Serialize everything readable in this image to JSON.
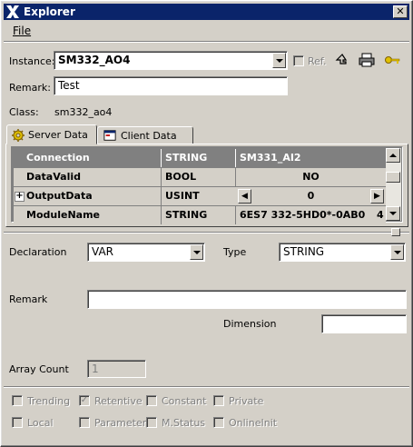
{
  "window": {
    "title": "Explorer"
  },
  "menu": {
    "file": "File"
  },
  "instance": {
    "label": "Instance:",
    "value": "SM332_AO4",
    "ref_label": "Ref."
  },
  "remark_top": {
    "label": "Remark:",
    "value": "Test"
  },
  "class_info": {
    "label": "Class:",
    "value": "sm332_ao4"
  },
  "tabs": [
    {
      "label": "Server Data"
    },
    {
      "label": "Client Data"
    }
  ],
  "grid": {
    "rows": [
      {
        "name": "Connection",
        "type": "STRING",
        "value": "SM331_AI2",
        "expand": ""
      },
      {
        "name": "DataValid",
        "type": "BOOL",
        "value": "NO",
        "expand": ""
      },
      {
        "name": "OutputData",
        "type": "USINT",
        "value": "0",
        "expand": "+"
      },
      {
        "name": "ModuleName",
        "type": "STRING",
        "value": "6ES7 332-5HD0*-0AB0",
        "extra": "4"
      }
    ]
  },
  "declaration": {
    "label": "Declaration",
    "value": "VAR"
  },
  "type": {
    "label": "Type",
    "value": "STRING"
  },
  "remark": {
    "label": "Remark",
    "value": ""
  },
  "dimension": {
    "label": "Dimension",
    "value": ""
  },
  "array_count": {
    "label": "Array Count",
    "value": "1"
  },
  "flags": {
    "trending": {
      "label": "Trending",
      "checked": false
    },
    "retentive": {
      "label": "Retentive",
      "checked": true
    },
    "constant": {
      "label": "Constant",
      "checked": false
    },
    "private": {
      "label": "Private",
      "checked": false
    },
    "local": {
      "label": "Local",
      "checked": false
    },
    "parameter": {
      "label": "Parameter",
      "checked": false
    },
    "mstatus": {
      "label": "M.Status",
      "checked": false
    },
    "onlineinit": {
      "label": "OnlineInit",
      "checked": false
    }
  },
  "colors": {
    "titlebar": "#0a246a",
    "grid_selected": "#808080",
    "face": "#d4d0c8"
  }
}
